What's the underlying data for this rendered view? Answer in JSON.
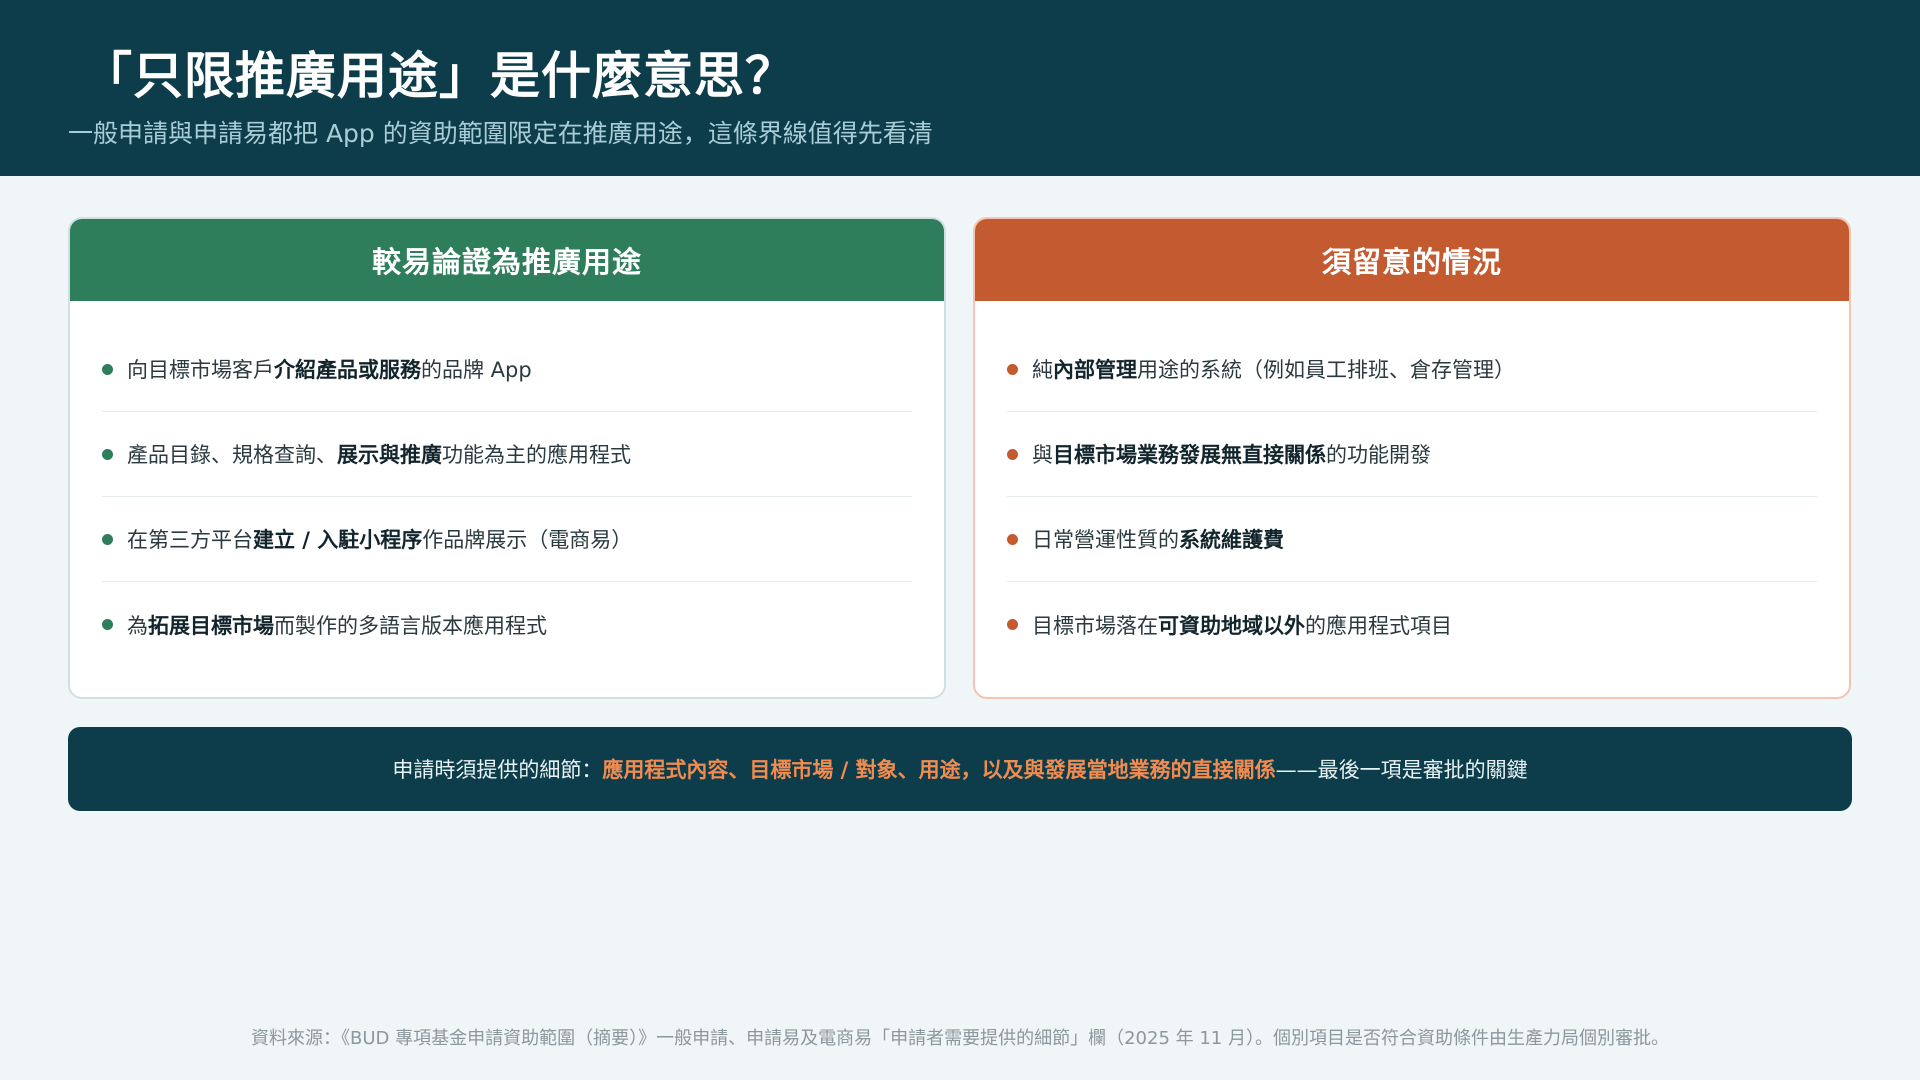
{
  "header": {
    "title": "「只限推廣用途」是什麼意思？",
    "subtitle": "一般申請與申請易都把 App 的資助範圍限定在推廣用途，這條界線值得先看清"
  },
  "colors": {
    "header_bg": "#0d3d4a",
    "positive": "#2e7d5b",
    "caution": "#c45a2f",
    "highlight": "#f28b50"
  },
  "left_card": {
    "heading": "較易論證為推廣用途",
    "items": [
      {
        "pre": "向目標市場客戶",
        "bold": "介紹產品或服務",
        "post": "的品牌 App"
      },
      {
        "pre": "產品目錄、規格查詢、",
        "bold": "展示與推廣",
        "post": "功能為主的應用程式"
      },
      {
        "pre": "在第三方平台",
        "bold": "建立 / 入駐小程序",
        "post": "作品牌展示（電商易）"
      },
      {
        "pre": "為",
        "bold": "拓展目標市場",
        "post": "而製作的多語言版本應用程式"
      }
    ]
  },
  "right_card": {
    "heading": "須留意的情況",
    "items": [
      {
        "pre": "純",
        "bold": "內部管理",
        "post": "用途的系統（例如員工排班、倉存管理）"
      },
      {
        "pre": "與",
        "bold": "目標市場業務發展無直接關係",
        "post": "的功能開發"
      },
      {
        "pre": "日常營運性質的",
        "bold": "系統維護費",
        "post": ""
      },
      {
        "pre": "目標市場落在",
        "bold": "可資助地域以外",
        "post": "的應用程式項目"
      }
    ]
  },
  "banner": {
    "pre": "申請時須提供的細節：",
    "highlight": "應用程式內容、目標市場 / 對象、用途，以及與發展當地業務的直接關係",
    "post": "——最後一項是審批的關鍵"
  },
  "footer": {
    "source": "資料來源：《BUD 專項基金申請資助範圍（摘要）》一般申請、申請易及電商易「申請者需要提供的細節」欄（2025 年 11 月）。個別項目是否符合資助條件由生產力局個別審批。"
  }
}
